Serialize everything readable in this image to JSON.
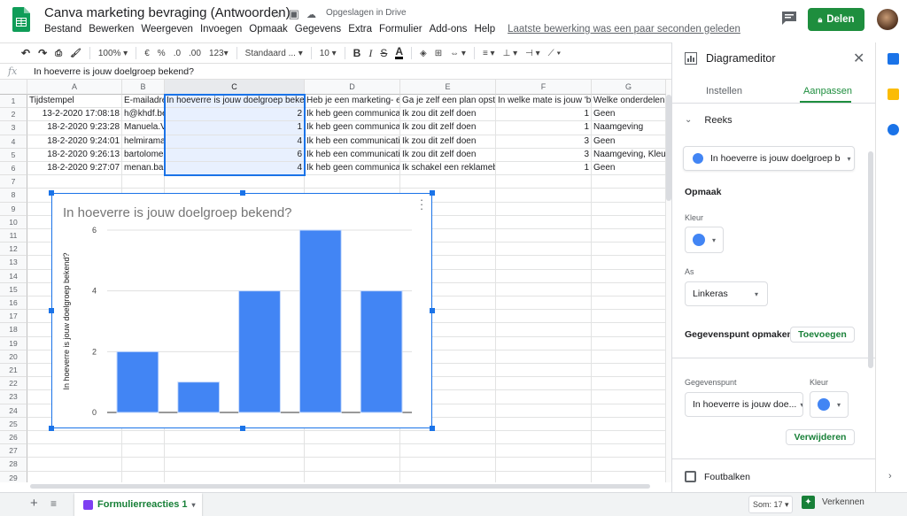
{
  "app": {
    "title": "Canva marketing bevraging (Antwoorden)",
    "saved_status": "Opgeslagen in Drive",
    "last_edit": "Laatste bewerking was een paar seconden geleden",
    "share_label": "Delen"
  },
  "menu": [
    "Bestand",
    "Bewerken",
    "Weergeven",
    "Invoegen",
    "Opmaak",
    "Gegevens",
    "Extra",
    "Formulier",
    "Add-ons",
    "Help"
  ],
  "toolbar": {
    "zoom": "100%",
    "currency": "€",
    "percent": "%",
    "decimal_less": ".0",
    "decimal_more": ".00",
    "format_more": "123",
    "font": "Standaard ...",
    "font_size": "10",
    "bold": "B",
    "italic": "I",
    "strike": "S",
    "text_color": "A"
  },
  "formula": {
    "fx": "fx",
    "content": "In hoeverre is jouw doelgroep bekend?"
  },
  "grid": {
    "columns": [
      "A",
      "B",
      "C",
      "D",
      "E",
      "F",
      "G"
    ],
    "rows": [
      "1",
      "2",
      "3",
      "4",
      "5",
      "6",
      "7",
      "8",
      "9",
      "10",
      "11",
      "12",
      "13",
      "14",
      "15",
      "16",
      "17",
      "18",
      "19",
      "20",
      "21",
      "22",
      "23",
      "24",
      "25",
      "26",
      "27",
      "28",
      "29"
    ],
    "headers": [
      "Tijdstempel",
      "E-mailadres",
      "In hoeverre is jouw doelgroep bekend?",
      "Heb je een marketing- en",
      "Ga je zelf een plan opste",
      "In welke mate is jouw 'bra",
      "Welke onderdelen"
    ],
    "data": [
      [
        "13-2-2020 17:08:18",
        "h@khdf.be",
        "2",
        "Ik heb geen communicatie",
        "Ik zou dit zelf doen",
        "1",
        "Geen"
      ],
      [
        "18-2-2020 9:23:28",
        "Manuela.Va",
        "1",
        "Ik heb geen communicatie",
        "Ik zou dit zelf doen",
        "1",
        "Naamgeving"
      ],
      [
        "18-2-2020 9:24:01",
        "helmiramac",
        "4",
        "Ik heb een communicatie",
        "Ik zou dit zelf doen",
        "3",
        "Geen"
      ],
      [
        "18-2-2020 9:26:13",
        "bartolomeo",
        "6",
        "Ik heb een communicatie",
        "Ik zou dit zelf doen",
        "3",
        "Naamgeving, Kleu"
      ],
      [
        "18-2-2020 9:27:07",
        "menan.bali",
        "4",
        "Ik heb geen communicatie",
        "Ik schakel een reklamebu",
        "1",
        "Geen"
      ]
    ]
  },
  "chart_data": {
    "type": "bar",
    "title": "In hoeverre is jouw doelgroep bekend?",
    "ylabel": "In hoeverre is jouw doelgroep bekend?",
    "xlabel": "",
    "values": [
      2,
      1,
      4,
      6,
      4
    ],
    "yticks": [
      "0",
      "2",
      "4",
      "6"
    ],
    "ylim": [
      0,
      6
    ],
    "color": "#4285f4",
    "grid": true
  },
  "sheet_tab": {
    "label": "Formulierreacties 1",
    "color": "#188038"
  },
  "status": {
    "sum": "Som: 17",
    "explore": "Verkennen"
  },
  "panel": {
    "title": "Diagrameditor",
    "tabs": [
      "Instellen",
      "Aanpassen"
    ],
    "section_series": "Reeks",
    "series_select": "In hoeverre is jouw doelgroep b",
    "format_heading": "Opmaak",
    "color_label": "Kleur",
    "axis_label": "As",
    "axis_value": "Linkeras",
    "datapoint_heading": "Gegevenspunt opmaken",
    "add_button": "Toevoegen",
    "datapoint_label": "Gegevenspunt",
    "datapoint_color_label": "Kleur",
    "datapoint_value": "In hoeverre is jouw doe...",
    "remove_button": "Verwijderen",
    "errorbars_label": "Foutbalken",
    "accent": "#1e8e3e",
    "series_color": "#4285f4"
  },
  "icons": [
    "sheets-logo-icon",
    "star-icon",
    "move-folder-icon",
    "cloud-done-icon",
    "comment-icon",
    "lock-icon",
    "undo-icon",
    "redo-icon",
    "print-icon",
    "paint-format-icon",
    "chart-icon",
    "close-icon",
    "chevron-down-icon",
    "checkbox-icon",
    "add-sheet-icon",
    "sheet-list-icon",
    "explore-icon",
    "calendar-icon",
    "keep-icon",
    "tasks-icon"
  ]
}
